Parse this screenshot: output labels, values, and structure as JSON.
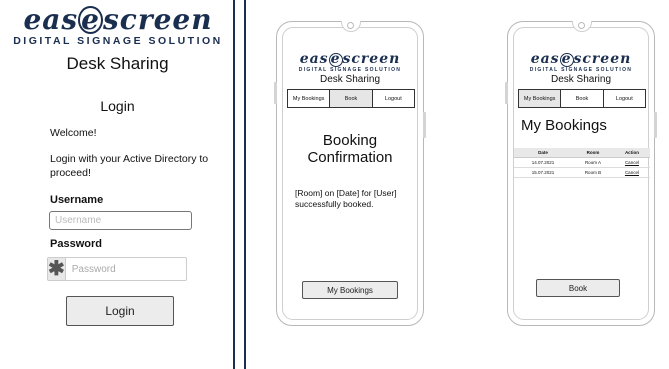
{
  "logo": {
    "word_start": "eas",
    "word_ring": "e",
    "word_end": "screen",
    "subtitle": "DIGITAL SIGNAGE SOLUTION"
  },
  "login_screen": {
    "title": "Desk Sharing",
    "heading": "Login",
    "welcome": "Welcome!",
    "instructions": "Login with your Active Directory to proceed!",
    "username_label": "Username",
    "username_placeholder": "Username",
    "password_label": "Password",
    "password_placeholder": "Password",
    "password_icon": "asterisk-icon",
    "login_button": "Login"
  },
  "tabs": [
    "My Bookings",
    "Book",
    "Logout"
  ],
  "confirmation_screen": {
    "title": "Desk Sharing",
    "heading": "Booking Confirmation",
    "message": "[Room] on [Date] for [User] successfully booked.",
    "button": "My Bookings"
  },
  "bookings_screen": {
    "title": "Desk Sharing",
    "heading": "My Bookings",
    "columns": [
      "Date",
      "Room",
      "Action"
    ],
    "rows": [
      [
        "14.07.2021",
        "Room A",
        "Cancel"
      ],
      [
        "15.07.2021",
        "Room B",
        "Cancel"
      ]
    ],
    "button": "Book"
  },
  "colors": {
    "brand": "#1a2e4f",
    "button_bg": "#ececec",
    "active_tab": "#e6e6e6"
  }
}
